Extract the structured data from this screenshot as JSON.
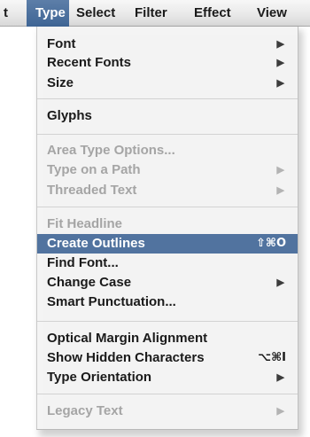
{
  "menubar": {
    "items": [
      {
        "label": "t"
      },
      {
        "label": "Type"
      },
      {
        "label": "Select"
      },
      {
        "label": "Filter"
      },
      {
        "label": "Effect"
      },
      {
        "label": "View"
      }
    ]
  },
  "type_menu": {
    "items": [
      {
        "label": "Font"
      },
      {
        "label": "Recent Fonts"
      },
      {
        "label": "Size"
      },
      {
        "label": "Glyphs"
      },
      {
        "label": "Area Type Options..."
      },
      {
        "label": "Type on a Path"
      },
      {
        "label": "Threaded Text"
      },
      {
        "label": "Fit Headline"
      },
      {
        "label": "Create Outlines",
        "shortcut": "⇧⌘O"
      },
      {
        "label": "Find Font..."
      },
      {
        "label": "Change Case"
      },
      {
        "label": "Smart Punctuation..."
      },
      {
        "label": "Optical Margin Alignment"
      },
      {
        "label": "Show Hidden Characters",
        "shortcut": "⌥⌘I"
      },
      {
        "label": "Type Orientation"
      },
      {
        "label": "Legacy Text"
      }
    ],
    "submenu_arrow": "▶"
  },
  "colors": {
    "highlight": "#51739f",
    "active_menubar": "#3f6595",
    "disabled_text": "#a5a5a5",
    "menu_background": "#f4f4f4"
  }
}
